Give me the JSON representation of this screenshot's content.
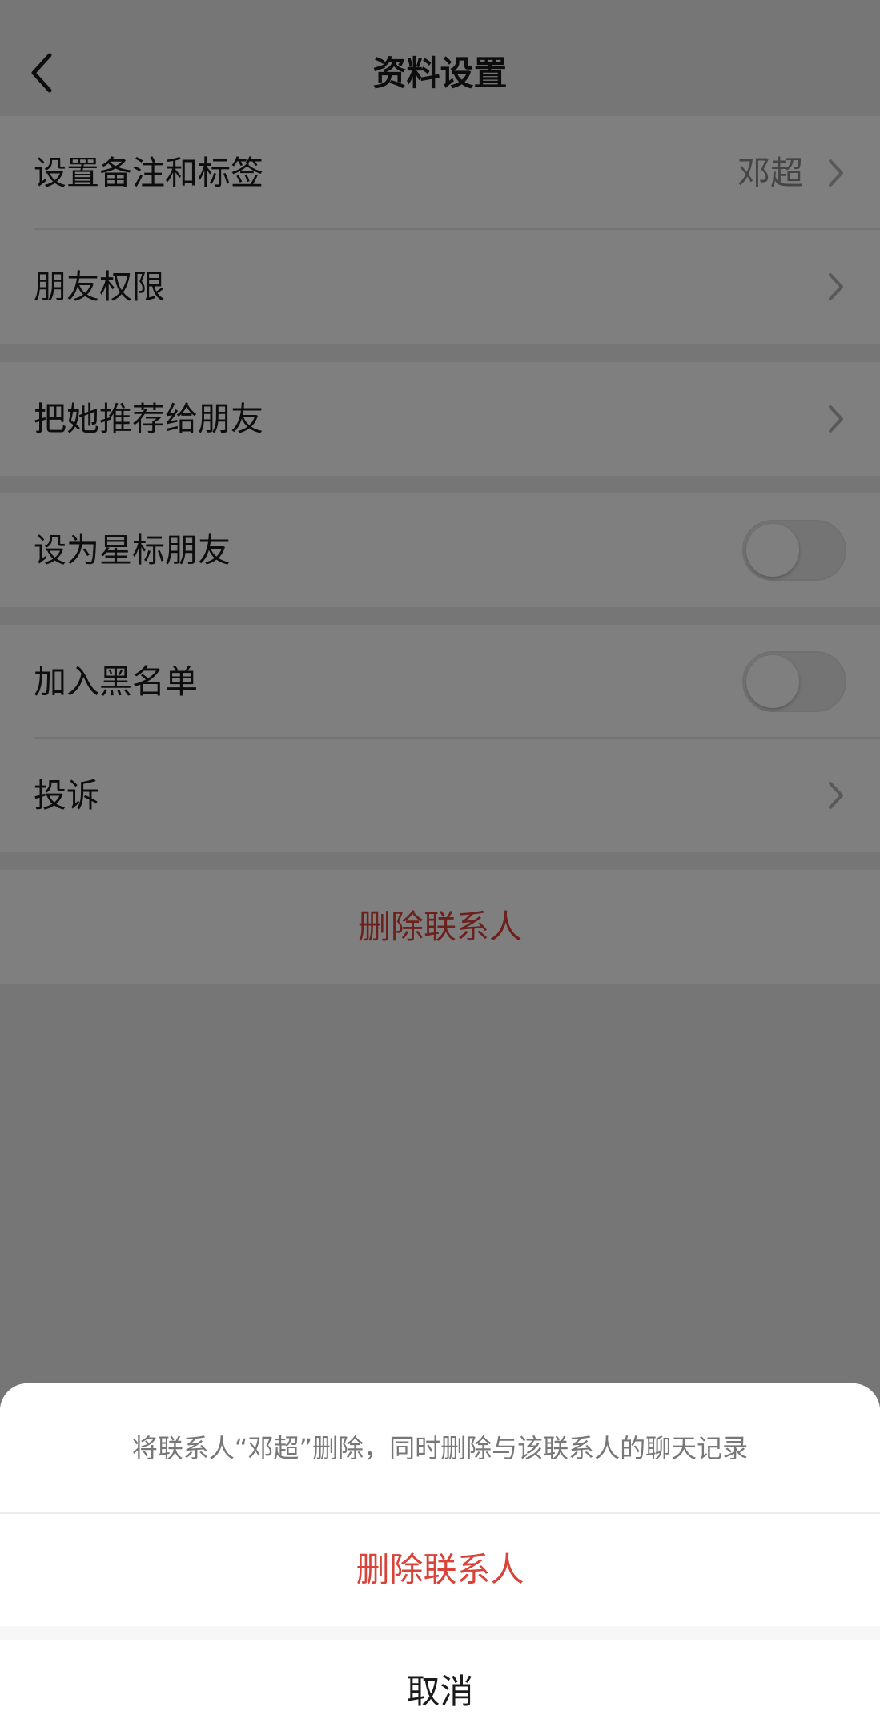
{
  "navbar": {
    "title": "资料设置",
    "back_icon": "chevron-left-icon"
  },
  "groups": {
    "remark": {
      "label": "设置备注和标签",
      "value": "邓超"
    },
    "permissions": {
      "label": "朋友权限"
    },
    "recommend": {
      "label": "把她推荐给朋友"
    },
    "star": {
      "label": "设为星标朋友",
      "toggle_on": false
    },
    "blacklist": {
      "label": "加入黑名单",
      "toggle_on": false
    },
    "complain": {
      "label": "投诉"
    },
    "delete": {
      "label": "删除联系人"
    }
  },
  "sheet": {
    "message": "将联系人“邓超”删除，同时删除与该联系人的聊天记录",
    "delete_label": "删除联系人",
    "cancel_label": "取消"
  },
  "colors": {
    "accent_red": "#d9433a",
    "background": "#ededed",
    "overlay": "rgba(0,0,0,0.5)"
  }
}
